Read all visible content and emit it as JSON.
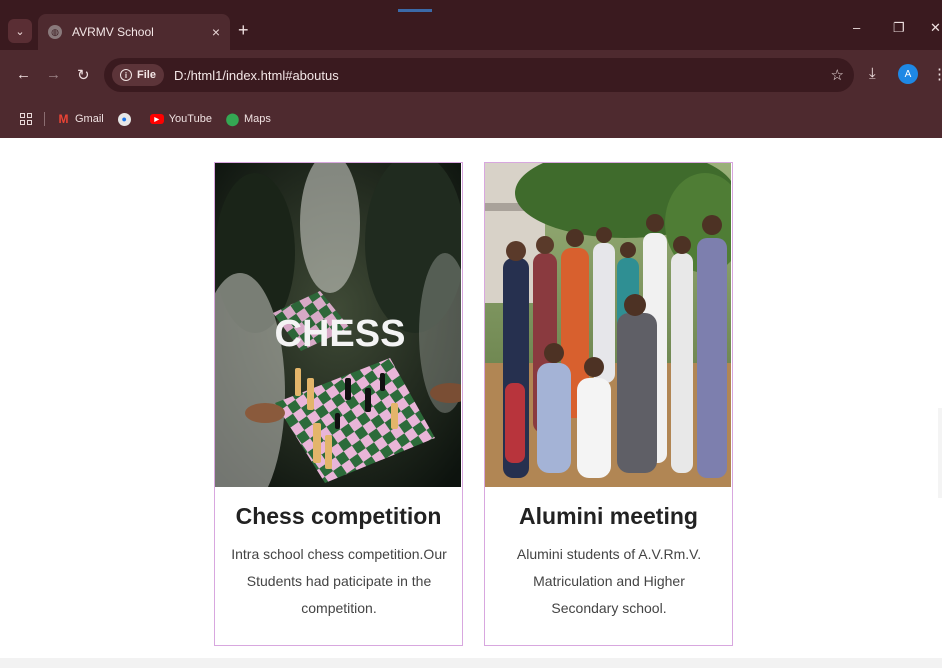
{
  "browser": {
    "tab_title": "AVRMV School",
    "tab_close": "×",
    "new_tab": "+",
    "url_chip": "File",
    "url": "D:/html1/index.html#aboutus",
    "avatar_letter": "A",
    "bookmarks": [
      {
        "label": "Gmail",
        "icon": "gmail-icon"
      },
      {
        "label": "",
        "icon": "edge-icon"
      },
      {
        "label": "YouTube",
        "icon": "youtube-icon"
      },
      {
        "label": "Maps",
        "icon": "maps-icon"
      }
    ]
  },
  "cards": [
    {
      "title": "Chess competition",
      "description": "Intra school chess competition.Our Students had paticipate in the competition.",
      "image_text": "CHESS"
    },
    {
      "title": "Alumini meeting",
      "description": "Alumini students of A.V.Rm.V. Matriculation and Higher Secondary school."
    }
  ],
  "colors": {
    "chrome_dark": "#3a1a1f",
    "chrome_mid": "#4e2a2f",
    "card_border": "#d8a7df"
  }
}
